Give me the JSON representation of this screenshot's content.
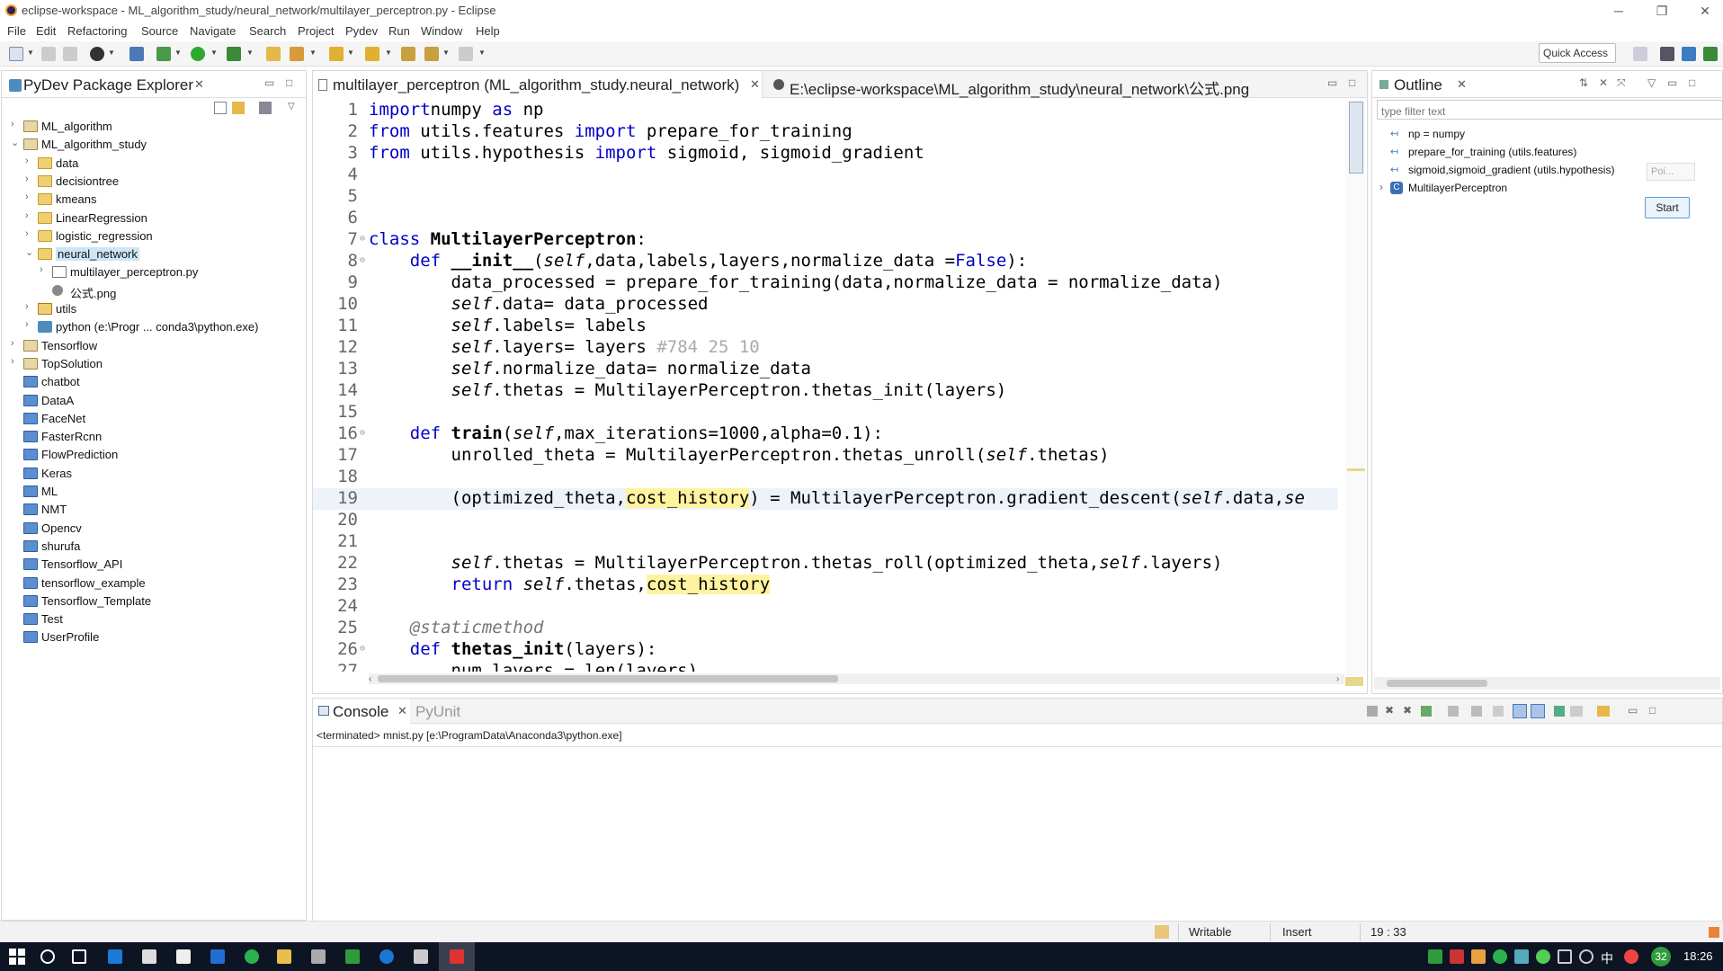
{
  "window": {
    "title": "eclipse-workspace - ML_algorithm_study/neural_network/multilayer_perceptron.py - Eclipse"
  },
  "menu": [
    "File",
    "Edit",
    "Refactoring",
    "Source",
    "Navigate",
    "Search",
    "Project",
    "Pydev",
    "Run",
    "Window",
    "Help"
  ],
  "toolbar": {
    "quick_access": "Quick Access"
  },
  "explorer": {
    "title": "PyDev Package Explorer",
    "items": [
      {
        "label": "ML_algorithm",
        "depth": 0,
        "icon": "project-icon",
        "arrow": "›"
      },
      {
        "label": "ML_algorithm_study",
        "depth": 0,
        "icon": "project-icon",
        "arrow": "⌄"
      },
      {
        "label": "data",
        "depth": 1,
        "icon": "folder-icon",
        "arrow": "›"
      },
      {
        "label": "decisiontree",
        "depth": 1,
        "icon": "folder-icon",
        "arrow": "›"
      },
      {
        "label": "kmeans",
        "depth": 1,
        "icon": "folder-icon",
        "arrow": "›"
      },
      {
        "label": "LinearRegression",
        "depth": 1,
        "icon": "folder-icon",
        "arrow": "›"
      },
      {
        "label": "logistic_regression",
        "depth": 1,
        "icon": "folder-icon",
        "arrow": "›"
      },
      {
        "label": "neural_network",
        "depth": 1,
        "icon": "folder-icon",
        "arrow": "⌄",
        "selected": true
      },
      {
        "label": "multilayer_perceptron.py",
        "depth": 2,
        "icon": "python-file-icon",
        "arrow": "›"
      },
      {
        "label": "公式.png",
        "depth": 2,
        "icon": "image-file-icon",
        "arrow": ""
      },
      {
        "label": "utils",
        "depth": 1,
        "icon": "package-icon",
        "arrow": "›"
      },
      {
        "label": "python  (e:\\Progr ... conda3\\python.exe)",
        "depth": 1,
        "icon": "interpreter-icon",
        "arrow": "›"
      },
      {
        "label": "Tensorflow",
        "depth": 0,
        "icon": "project-icon",
        "arrow": "›"
      },
      {
        "label": "TopSolution",
        "depth": 0,
        "icon": "project-icon",
        "arrow": "›"
      },
      {
        "label": "chatbot",
        "depth": 0,
        "icon": "closed-project-icon",
        "arrow": ""
      },
      {
        "label": "DataA",
        "depth": 0,
        "icon": "closed-project-icon",
        "arrow": ""
      },
      {
        "label": "FaceNet",
        "depth": 0,
        "icon": "closed-project-icon",
        "arrow": ""
      },
      {
        "label": "FasterRcnn",
        "depth": 0,
        "icon": "closed-project-icon",
        "arrow": ""
      },
      {
        "label": "FlowPrediction",
        "depth": 0,
        "icon": "closed-project-icon",
        "arrow": ""
      },
      {
        "label": "Keras",
        "depth": 0,
        "icon": "closed-project-icon",
        "arrow": ""
      },
      {
        "label": "ML",
        "depth": 0,
        "icon": "closed-project-icon",
        "arrow": ""
      },
      {
        "label": "NMT",
        "depth": 0,
        "icon": "closed-project-icon",
        "arrow": ""
      },
      {
        "label": "Opencv",
        "depth": 0,
        "icon": "closed-project-icon",
        "arrow": ""
      },
      {
        "label": "shurufa",
        "depth": 0,
        "icon": "closed-project-icon",
        "arrow": ""
      },
      {
        "label": "Tensorflow_API",
        "depth": 0,
        "icon": "closed-project-icon",
        "arrow": ""
      },
      {
        "label": "tensorflow_example",
        "depth": 0,
        "icon": "closed-project-icon",
        "arrow": ""
      },
      {
        "label": "Tensorflow_Template",
        "depth": 0,
        "icon": "closed-project-icon",
        "arrow": ""
      },
      {
        "label": "Test",
        "depth": 0,
        "icon": "closed-project-icon",
        "arrow": ""
      },
      {
        "label": "UserProfile",
        "depth": 0,
        "icon": "closed-project-icon",
        "arrow": ""
      }
    ]
  },
  "editor": {
    "tabs": [
      {
        "label": "multilayer_perceptron (ML_algorithm_study.neural_network)",
        "active": true
      },
      {
        "label": "E:\\eclipse-workspace\\ML_algorithm_study\\neural_network\\公式.png",
        "active": false
      }
    ],
    "lines": [
      [
        [
          "kw",
          "import"
        ],
        [
          "",
          "numpy"
        ],
        [
          "kw",
          " as"
        ],
        [
          "",
          " np"
        ]
      ],
      [
        [
          "kw",
          "from"
        ],
        [
          "",
          " utils.features "
        ],
        [
          "kw",
          "import"
        ],
        [
          "",
          " prepare_for_training"
        ]
      ],
      [
        [
          "kw",
          "from"
        ],
        [
          "",
          " utils.hypothesis "
        ],
        [
          "kw",
          "import"
        ],
        [
          "",
          " sigmoid, sigmoid_gradient"
        ]
      ],
      [],
      [],
      [],
      [
        [
          "kw",
          "class "
        ],
        [
          "fn",
          "MultilayerPerceptron"
        ],
        [
          "",
          ":"
        ]
      ],
      [
        [
          "",
          "    "
        ],
        [
          "kw",
          "def "
        ],
        [
          "fn",
          "__init__"
        ],
        [
          "",
          "("
        ],
        [
          "sf",
          "self"
        ],
        [
          "",
          ",data,labels,layers,normalize_data ="
        ],
        [
          "kw",
          "False"
        ],
        [
          "",
          "):"
        ]
      ],
      [
        [
          "",
          "        data_processed = prepare_for_training(data,normalize_data = normalize_data)"
        ]
      ],
      [
        [
          "",
          "        "
        ],
        [
          "sf",
          "self"
        ],
        [
          "",
          ".data= data_processed"
        ]
      ],
      [
        [
          "",
          "        "
        ],
        [
          "sf",
          "self"
        ],
        [
          "",
          ".labels= labels"
        ]
      ],
      [
        [
          "",
          "        "
        ],
        [
          "sf",
          "self"
        ],
        [
          "",
          ".layers= layers "
        ],
        [
          "cm",
          "#784 25 10"
        ]
      ],
      [
        [
          "",
          "        "
        ],
        [
          "sf",
          "self"
        ],
        [
          "",
          ".normalize_data= normalize_data"
        ]
      ],
      [
        [
          "",
          "        "
        ],
        [
          "sf",
          "self"
        ],
        [
          "",
          ".thetas = MultilayerPerceptron.thetas_init(layers)"
        ]
      ],
      [],
      [
        [
          "",
          "    "
        ],
        [
          "kw",
          "def "
        ],
        [
          "fn",
          "train"
        ],
        [
          "",
          "("
        ],
        [
          "sf",
          "self"
        ],
        [
          "",
          ",max_iterations=1000,alpha=0.1):"
        ]
      ],
      [
        [
          "",
          "        unrolled_theta = MultilayerPerceptron.thetas_unroll("
        ],
        [
          "sf",
          "self"
        ],
        [
          "",
          ".thetas)"
        ]
      ],
      [],
      [
        [
          "",
          "        (optimized_theta,"
        ],
        [
          "hl",
          "cost_history"
        ],
        [
          "",
          ") = MultilayerPerceptron.gradient_descent("
        ],
        [
          "sf",
          "self"
        ],
        [
          "",
          ".data,"
        ],
        [
          "sf",
          "se"
        ]
      ],
      [],
      [],
      [
        [
          "",
          "        "
        ],
        [
          "sf",
          "self"
        ],
        [
          "",
          ".thetas = MultilayerPerceptron.thetas_roll(optimized_theta,"
        ],
        [
          "sf",
          "self"
        ],
        [
          "",
          ".layers)"
        ]
      ],
      [
        [
          "",
          "        "
        ],
        [
          "kw",
          "return "
        ],
        [
          "sf",
          "self"
        ],
        [
          "",
          ".thetas,"
        ],
        [
          "hl",
          "cost_history"
        ]
      ],
      [],
      [
        [
          "",
          "    "
        ],
        [
          "dec",
          "@staticmethod"
        ]
      ],
      [
        [
          "",
          "    "
        ],
        [
          "kw",
          "def "
        ],
        [
          "fn",
          "thetas_init"
        ],
        [
          "",
          "(layers):"
        ]
      ],
      [
        [
          "",
          "        num_layers = len(layers)"
        ]
      ]
    ]
  },
  "outline": {
    "title": "Outline",
    "filter_placeholder": "type filter text",
    "items": [
      {
        "label": "np = numpy",
        "icon": "import-icon"
      },
      {
        "label": "prepare_for_training (utils.features)",
        "icon": "import-icon"
      },
      {
        "label": "sigmoid,sigmoid_gradient (utils.hypothesis)",
        "icon": "import-icon"
      },
      {
        "label": "MultilayerPerceptron",
        "icon": "class-icon"
      }
    ],
    "popup_label": "Poi...",
    "start_label": "Start"
  },
  "console": {
    "tabs": [
      {
        "label": "Console",
        "active": true
      },
      {
        "label": "PyUnit",
        "active": false
      }
    ],
    "status": "<terminated> mnist.py [e:\\ProgramData\\Anaconda3\\python.exe]"
  },
  "statusbar": {
    "writable": "Writable",
    "insert": "Insert",
    "position": "19 : 33"
  },
  "taskbar": {
    "time": "18:26",
    "badge": "32",
    "ime": "中"
  }
}
